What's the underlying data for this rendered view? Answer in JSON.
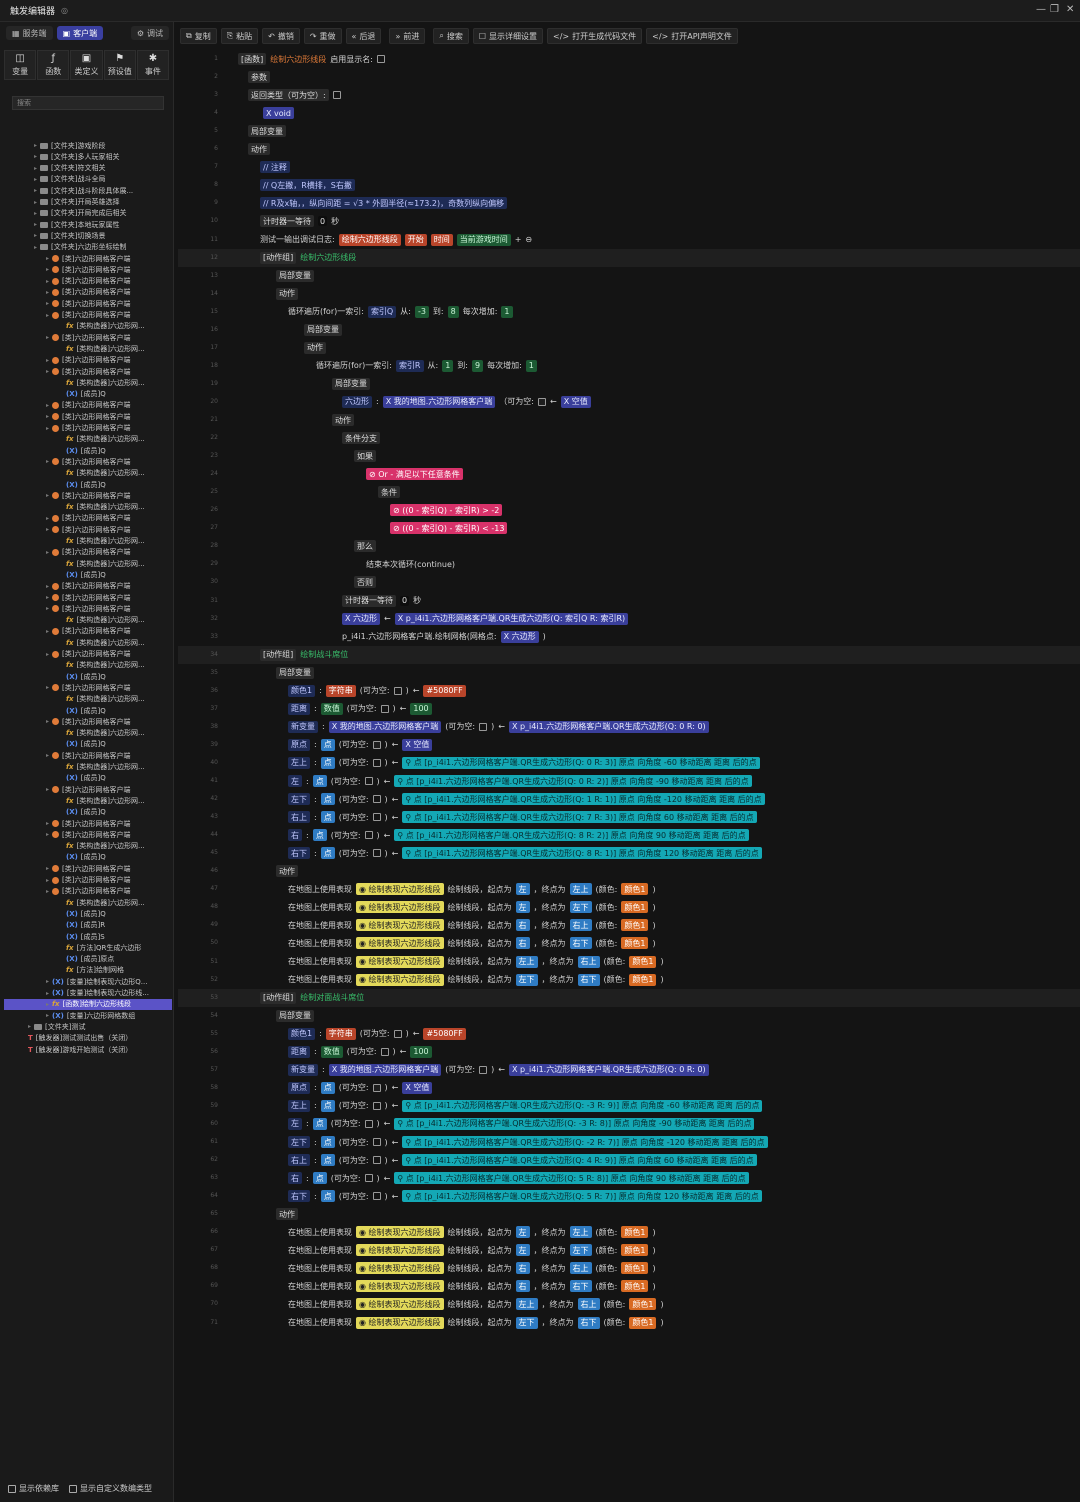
{
  "window": {
    "title": "触发编辑器"
  },
  "sidebar": {
    "tabs": [
      {
        "label": "服务端"
      },
      {
        "label": "客户端"
      },
      {
        "label": "调试"
      }
    ],
    "tools": [
      {
        "label": "变量",
        "icon": "variable-icon"
      },
      {
        "label": "函数",
        "icon": "function-icon"
      },
      {
        "label": "类定义",
        "icon": "class-icon"
      },
      {
        "label": "预设值",
        "icon": "preset-icon"
      },
      {
        "label": "事件",
        "icon": "event-icon"
      }
    ],
    "search_placeholder": "搜索",
    "tree": [
      {
        "t": "[文件夹]游戏阶段",
        "k": "folder",
        "d": 0
      },
      {
        "t": "[文件夹]多人玩家相关",
        "k": "folder",
        "d": 0
      },
      {
        "t": "[文件夹]符文相关",
        "k": "folder",
        "d": 0
      },
      {
        "t": "[文件夹]战斗全局",
        "k": "folder",
        "d": 0
      },
      {
        "t": "[文件夹]战斗阶段具体展...",
        "k": "folder",
        "d": 0
      },
      {
        "t": "[文件夹]开局英雄选择",
        "k": "folder",
        "d": 0
      },
      {
        "t": "[文件夹]开局完成后相关",
        "k": "folder",
        "d": 0
      },
      {
        "t": "[文件夹]本地玩家属性",
        "k": "folder",
        "d": 0
      },
      {
        "t": "[文件夹]切换场景",
        "k": "folder",
        "d": 0
      },
      {
        "t": "[文件夹]六边形坐标绘制",
        "k": "folder",
        "d": 0
      },
      {
        "t": "[类]六边形网格客户端",
        "k": "class",
        "d": 1
      },
      {
        "t": "[类]六边形网格客户端",
        "k": "class",
        "d": 1
      },
      {
        "t": "[类]六边形网格客户端",
        "k": "class",
        "d": 1
      },
      {
        "t": "[类]六边形网格客户端",
        "k": "class",
        "d": 1
      },
      {
        "t": "[类]六边形网格客户端",
        "k": "class",
        "d": 1
      },
      {
        "t": "[类]六边形网格客户端",
        "k": "class",
        "d": 1
      },
      {
        "t": "[类构造器]六边形网...",
        "k": "fx",
        "d": 2
      },
      {
        "t": "[类]六边形网格客户端",
        "k": "class",
        "d": 1
      },
      {
        "t": "[类构造器]六边形网...",
        "k": "fx",
        "d": 2
      },
      {
        "t": "[类]六边形网格客户端",
        "k": "class",
        "d": 1
      },
      {
        "t": "[类]六边形网格客户端",
        "k": "class",
        "d": 1
      },
      {
        "t": "[类构造器]六边形网...",
        "k": "fx",
        "d": 2
      },
      {
        "t": "[成员]Q",
        "k": "var",
        "d": 2
      },
      {
        "t": "[类]六边形网格客户端",
        "k": "class",
        "d": 1
      },
      {
        "t": "[类]六边形网格客户端",
        "k": "class",
        "d": 1
      },
      {
        "t": "[类]六边形网格客户端",
        "k": "class",
        "d": 1
      },
      {
        "t": "[类构造器]六边形网...",
        "k": "fx",
        "d": 2
      },
      {
        "t": "[成员]Q",
        "k": "var",
        "d": 2
      },
      {
        "t": "[类]六边形网格客户端",
        "k": "class",
        "d": 1
      },
      {
        "t": "[类构造器]六边形网...",
        "k": "fx",
        "d": 2
      },
      {
        "t": "[成员]Q",
        "k": "var",
        "d": 2
      },
      {
        "t": "[类]六边形网格客户端",
        "k": "class",
        "d": 1
      },
      {
        "t": "[类构造器]六边形网...",
        "k": "fx",
        "d": 2
      },
      {
        "t": "[类]六边形网格客户端",
        "k": "class",
        "d": 1
      },
      {
        "t": "[类]六边形网格客户端",
        "k": "class",
        "d": 1
      },
      {
        "t": "[类构造器]六边形网...",
        "k": "fx",
        "d": 2
      },
      {
        "t": "[类]六边形网格客户端",
        "k": "class",
        "d": 1
      },
      {
        "t": "[类构造器]六边形网...",
        "k": "fx",
        "d": 2
      },
      {
        "t": "[成员]Q",
        "k": "var",
        "d": 2
      },
      {
        "t": "[类]六边形网格客户端",
        "k": "class",
        "d": 1
      },
      {
        "t": "[类]六边形网格客户端",
        "k": "class",
        "d": 1
      },
      {
        "t": "[类]六边形网格客户端",
        "k": "class",
        "d": 1
      },
      {
        "t": "[类构造器]六边形网...",
        "k": "fx",
        "d": 2
      },
      {
        "t": "[类]六边形网格客户端",
        "k": "class",
        "d": 1
      },
      {
        "t": "[类构造器]六边形网...",
        "k": "fx",
        "d": 2
      },
      {
        "t": "[类]六边形网格客户端",
        "k": "class",
        "d": 1
      },
      {
        "t": "[类构造器]六边形网...",
        "k": "fx",
        "d": 2
      },
      {
        "t": "[成员]Q",
        "k": "var",
        "d": 2
      },
      {
        "t": "[类]六边形网格客户端",
        "k": "class",
        "d": 1
      },
      {
        "t": "[类构造器]六边形网...",
        "k": "fx",
        "d": 2
      },
      {
        "t": "[成员]Q",
        "k": "var",
        "d": 2
      },
      {
        "t": "[类]六边形网格客户端",
        "k": "class",
        "d": 1
      },
      {
        "t": "[类构造器]六边形网...",
        "k": "fx",
        "d": 2
      },
      {
        "t": "[成员]Q",
        "k": "var",
        "d": 2
      },
      {
        "t": "[类]六边形网格客户端",
        "k": "class",
        "d": 1
      },
      {
        "t": "[类构造器]六边形网...",
        "k": "fx",
        "d": 2
      },
      {
        "t": "[成员]Q",
        "k": "var",
        "d": 2
      },
      {
        "t": "[类]六边形网格客户端",
        "k": "class",
        "d": 1
      },
      {
        "t": "[类构造器]六边形网...",
        "k": "fx",
        "d": 2
      },
      {
        "t": "[成员]Q",
        "k": "var",
        "d": 2
      },
      {
        "t": "[类]六边形网格客户端",
        "k": "class",
        "d": 1
      },
      {
        "t": "[类]六边形网格客户端",
        "k": "class",
        "d": 1
      },
      {
        "t": "[类构造器]六边形网...",
        "k": "fx",
        "d": 2
      },
      {
        "t": "[成员]Q",
        "k": "var",
        "d": 2
      },
      {
        "t": "[类]六边形网格客户端",
        "k": "class",
        "d": 1
      },
      {
        "t": "[类]六边形网格客户端",
        "k": "class",
        "d": 1
      },
      {
        "t": "[类]六边形网格客户端",
        "k": "class",
        "d": 1
      },
      {
        "t": "[类构造器]六边形网...",
        "k": "fx",
        "d": 2
      },
      {
        "t": "[成员]Q",
        "k": "var",
        "d": 2
      },
      {
        "t": "[成员]R",
        "k": "var",
        "d": 2
      },
      {
        "t": "[成员]S",
        "k": "var",
        "d": 2
      },
      {
        "t": "[方法]QR生成六边形",
        "k": "fx",
        "d": 2
      },
      {
        "t": "[成员]原点",
        "k": "var",
        "d": 2
      },
      {
        "t": "[方法]绘制网格",
        "k": "fx",
        "d": 2
      },
      {
        "t": "[变量]绘制表现六边形Q...",
        "k": "var",
        "d": 1
      },
      {
        "t": "[变量]绘制表现六边形线...",
        "k": "var",
        "d": 1
      },
      {
        "t": "[函数]绘制六边形线段",
        "k": "fx",
        "d": 1,
        "sel": true
      },
      {
        "t": "[变量]六边形网格数组",
        "k": "var",
        "d": 1
      },
      {
        "t": "[文件夹]测试",
        "k": "folder",
        "d": 0
      },
      {
        "t": "[触发器]测试测试出售（关闭）",
        "k": "trig",
        "d": 0
      },
      {
        "t": "[触发器]游戏开始测试（关闭）",
        "k": "trig",
        "d": 0
      }
    ],
    "footer": {
      "dep": "显示依赖库",
      "custom": "显示自定义数编类型"
    }
  },
  "toolbar": [
    "复制",
    "粘贴",
    "撤销",
    "重做",
    "后退",
    "前进",
    "搜索",
    "显示详细设置",
    "打开生成代码文件",
    "打开API声明文件"
  ],
  "editor": {
    "fn_tag": "[函数]",
    "fn_name": "绘制六边形线段",
    "fn_show": "启用显示名:",
    "params": "参数",
    "ret": "返回类型（可为空）:",
    "void": "void",
    "local": "局部变量",
    "action": "动作",
    "c1": "注释",
    "c2": "Q左撇，R横排，S右撇",
    "c3": "R及x轴，，纵向间距 = √3 * 外圆半径(≈173.2)，奇数列纵向偏移",
    "timer": "计时器一等待",
    "zero": "0",
    "sec": "秒",
    "log": "测试一输出调试日志:",
    "log_a": "绘制六边形线段",
    "log_b": "开始",
    "log_c": "时间",
    "log_d": "当前游戏时间",
    "g1": "[动作组]",
    "g1n": "绘制六边形线段",
    "for1": "循环遍历(for)一索引:",
    "idxQ": "索引Q",
    "from": "从:",
    "to": "到:",
    "step": "每次增加:",
    "m3": "-3",
    "p8": "8",
    "one": "1",
    "for2": "循环遍历(for)一索引:",
    "idxR": "索引R",
    "p9": "9",
    "hexvar": "六边形",
    "mapcls": "我的地图.六边形网格客户端",
    "nullable": "（可为空:",
    "nullv": "空值",
    "branch": "条件分支",
    "if": "如果",
    "or": "Or - 满足以下任意条件",
    "cond": "条件",
    "i1Q": "索引Q",
    "i1R": "索引R",
    "gt": ">",
    "lt": "<",
    "v2": "-2",
    "v13": "-13",
    "then": "那么",
    "cont": "结束本次循环(continue)",
    "else": "否则",
    "assign": "p_i4i1.六边形网格客户端.QR生成六边形(Q:",
    "rlab": "R:",
    "draw": "p_i4i1.六边形网格客户端.绘制网格(网格点:",
    "g2n": "绘制战斗席位",
    "g3n": "绘制对面战斗席位",
    "color": "颜色1",
    "strtype": "字符串",
    "hex": "#5080FF",
    "dist": "距离",
    "numtype": "数值",
    "v100": "100",
    "newvar": "新变量",
    "origin": "原点",
    "pttype": "点",
    "lt_u": "左上",
    "l": "左",
    "lt_d": "左下",
    "rt_u": "右上",
    "r": "右",
    "rt_d": "右下",
    "gen": "p_i4i1.六边形网格客户端.QR生成六边形(Q:",
    "orig": "原点",
    "ang": "向角度",
    "mv": "移动距离",
    "after": "后的点",
    "map": "在地图上使用表现",
    "drawseg": "绘制表现六边形线段",
    "seg": "绘制线段，起点为",
    "endp": "，终点为",
    "colp": "(颜色:"
  }
}
